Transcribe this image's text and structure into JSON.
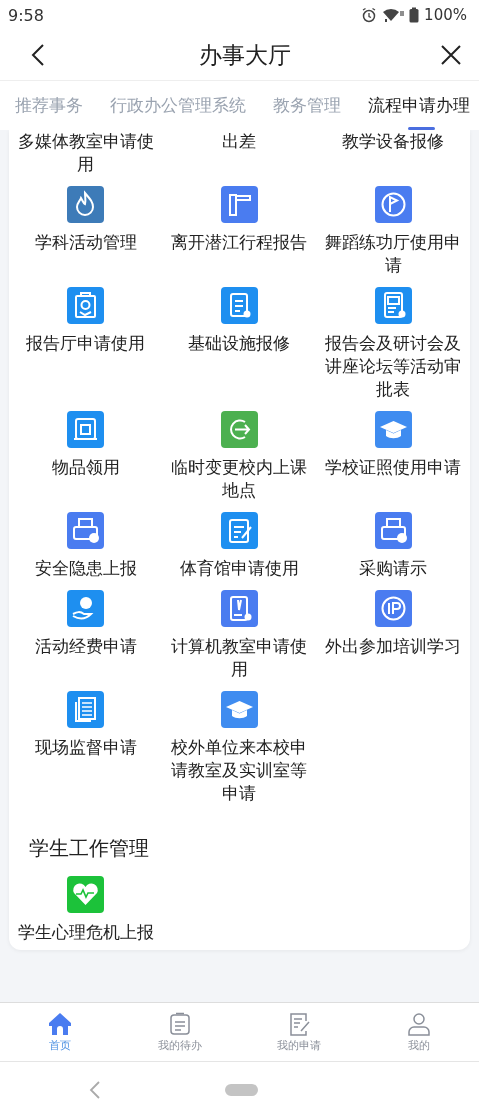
{
  "status_bar": {
    "time": "9:58",
    "battery": "100%"
  },
  "header": {
    "title": "办事大厅"
  },
  "tabs": [
    {
      "label": "推荐事务",
      "selected": false
    },
    {
      "label": "行政办公管理系统",
      "selected": false
    },
    {
      "label": "教务管理",
      "selected": false
    },
    {
      "label": "流程申请办理",
      "selected": true
    }
  ],
  "sections": [
    {
      "items": [
        {
          "label": "多媒体教室申请使用"
        },
        {
          "label": "出差"
        },
        {
          "label": "教学设备报修"
        },
        {
          "label": "学科活动管理",
          "color": "#3d7bb8"
        },
        {
          "label": "离开潜江行程报告",
          "color": "#4a7cf0"
        },
        {
          "label": "舞蹈练功厅使用申请",
          "color": "#4a7cf0"
        },
        {
          "label": "报告厅申请使用",
          "color": "#1e8ff0"
        },
        {
          "label": "基础设施报修",
          "color": "#1e8ff0"
        },
        {
          "label": "报告会及研讨会及讲座论坛等活动审批表",
          "color": "#1e8ff0"
        },
        {
          "label": "物品领用",
          "color": "#1e8ff0"
        },
        {
          "label": "临时变更校内上课地点",
          "color": "#4cb050"
        },
        {
          "label": "学校证照使用申请",
          "color": "#3f8cf0"
        },
        {
          "label": "安全隐患上报",
          "color": "#4a7cf0"
        },
        {
          "label": "体育馆申请使用",
          "color": "#1e8ff0"
        },
        {
          "label": "采购请示",
          "color": "#4a7cf0"
        },
        {
          "label": "活动经费申请",
          "color": "#1e8ff0"
        },
        {
          "label": "计算机教室申请使用",
          "color": "#4a7cf0"
        },
        {
          "label": "外出参加培训学习",
          "color": "#4a7cf0"
        },
        {
          "label": "现场监督申请",
          "color": "#1e8ff0"
        },
        {
          "label": "校外单位来本校申请教室及实训室等申请",
          "color": "#3f8cf0"
        }
      ]
    },
    {
      "title": "学生工作管理",
      "items": [
        {
          "label": "学生心理危机上报",
          "color": "#1cc23a"
        }
      ]
    }
  ],
  "bottom_nav": [
    {
      "label": "首页",
      "selected": true
    },
    {
      "label": "我的待办",
      "selected": false
    },
    {
      "label": "我的申请",
      "selected": false
    },
    {
      "label": "我的",
      "selected": false
    }
  ]
}
